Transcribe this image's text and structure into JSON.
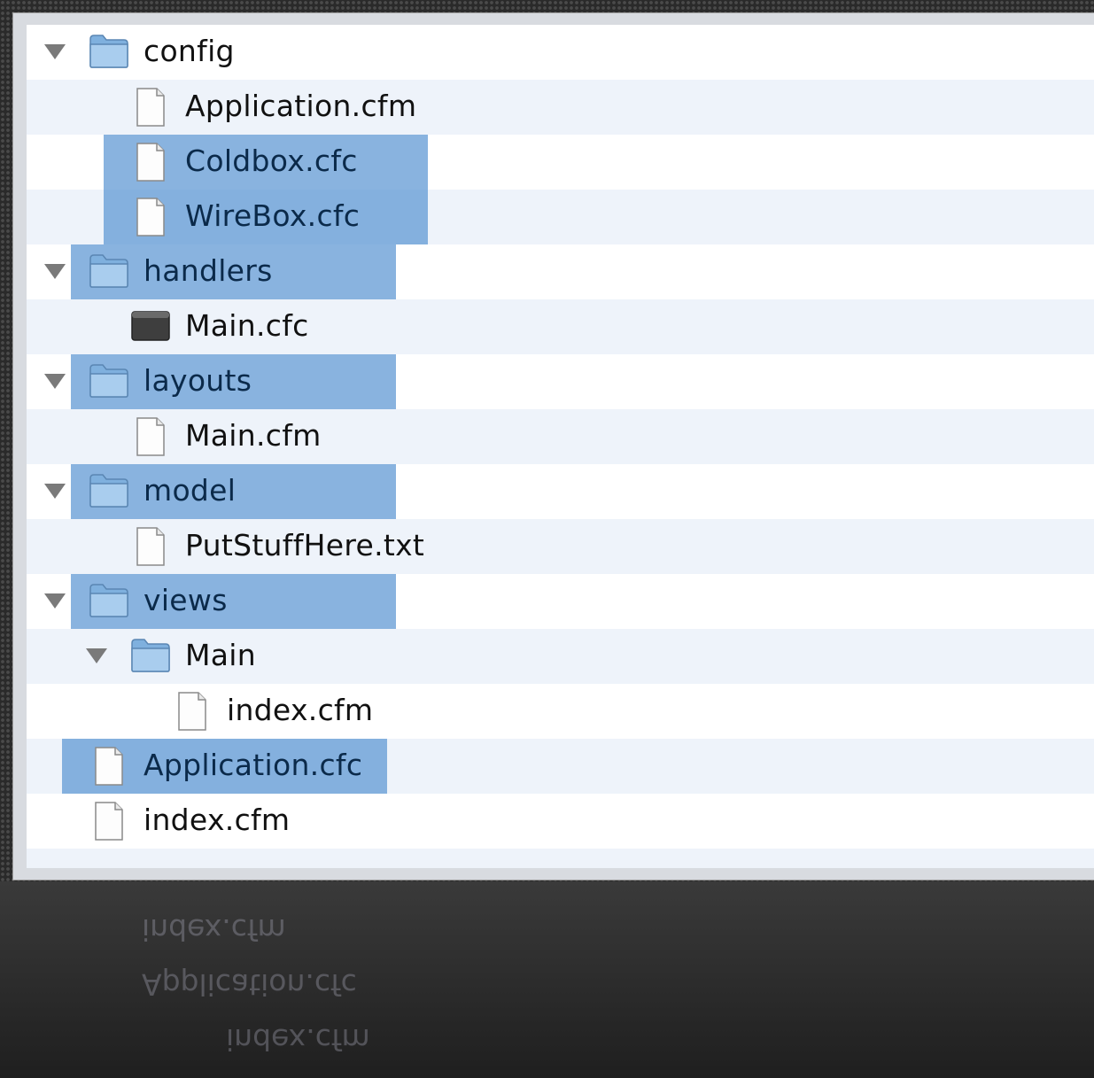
{
  "tree": [
    {
      "label": "config",
      "kind": "folder",
      "depth": 0,
      "expanded": true,
      "selected": false
    },
    {
      "label": "Application.cfm",
      "kind": "file",
      "depth": 1,
      "selected": false
    },
    {
      "label": "Coldbox.cfc",
      "kind": "file",
      "depth": 1,
      "selected": true
    },
    {
      "label": "WireBox.cfc",
      "kind": "file",
      "depth": 1,
      "selected": true
    },
    {
      "label": "handlers",
      "kind": "folder",
      "depth": 0,
      "expanded": true,
      "selected": true
    },
    {
      "label": "Main.cfc",
      "kind": "file-dark",
      "depth": 1,
      "selected": false
    },
    {
      "label": "layouts",
      "kind": "folder",
      "depth": 0,
      "expanded": true,
      "selected": true
    },
    {
      "label": "Main.cfm",
      "kind": "file",
      "depth": 1,
      "selected": false
    },
    {
      "label": "model",
      "kind": "folder",
      "depth": 0,
      "expanded": true,
      "selected": true
    },
    {
      "label": "PutStuffHere.txt",
      "kind": "file",
      "depth": 1,
      "selected": false
    },
    {
      "label": "views",
      "kind": "folder",
      "depth": 0,
      "expanded": true,
      "selected": true
    },
    {
      "label": "Main",
      "kind": "folder",
      "depth": 1,
      "expanded": true,
      "selected": false
    },
    {
      "label": "index.cfm",
      "kind": "file",
      "depth": 2,
      "selected": false
    },
    {
      "label": "Application.cfc",
      "kind": "file",
      "depth": 0,
      "selected": true
    },
    {
      "label": "index.cfm",
      "kind": "file",
      "depth": 0,
      "selected": false
    }
  ],
  "colors": {
    "highlight": "#5c96d2",
    "row_alt": "#eef3fa",
    "background": "#2a2a2a"
  },
  "icons": {
    "folder": "folder-icon",
    "file": "file-icon",
    "file-dark": "dark-file-icon",
    "disclosure": "disclosure-triangle-icon"
  }
}
